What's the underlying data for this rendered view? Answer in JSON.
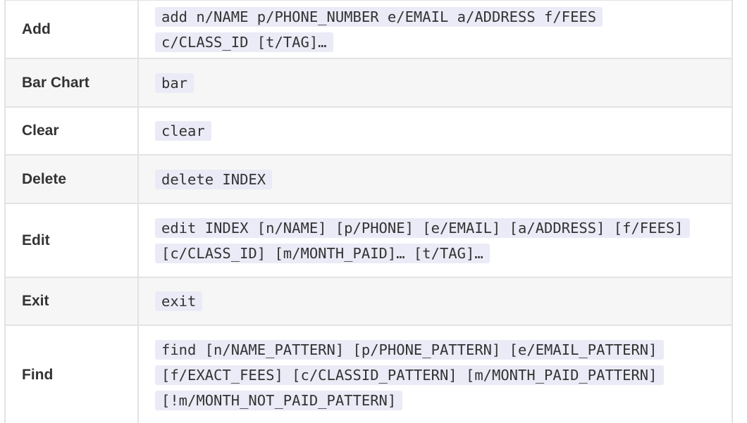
{
  "commands": [
    {
      "action": "Add",
      "format": "add n/NAME p/PHONE_NUMBER e/EMAIL a/ADDRESS f/FEES c/CLASS_ID [t/TAG]…"
    },
    {
      "action": "Bar Chart",
      "format": "bar"
    },
    {
      "action": "Clear",
      "format": "clear"
    },
    {
      "action": "Delete",
      "format": "delete INDEX"
    },
    {
      "action": "Edit",
      "format": "edit INDEX [n/NAME] [p/PHONE] [e/EMAIL] [a/ADDRESS] [f/FEES] [c/CLASS_ID] [m/MONTH_PAID]… [t/TAG]…"
    },
    {
      "action": "Exit",
      "format": "exit"
    },
    {
      "action": "Find",
      "format": "find [n/NAME_PATTERN] [p/PHONE_PATTERN] [e/EMAIL_PATTERN] [f/EXACT_FEES] [c/CLASSID_PATTERN] [m/MONTH_PAID_PATTERN] [!m/MONTH_NOT_PAID_PATTERN]"
    }
  ]
}
